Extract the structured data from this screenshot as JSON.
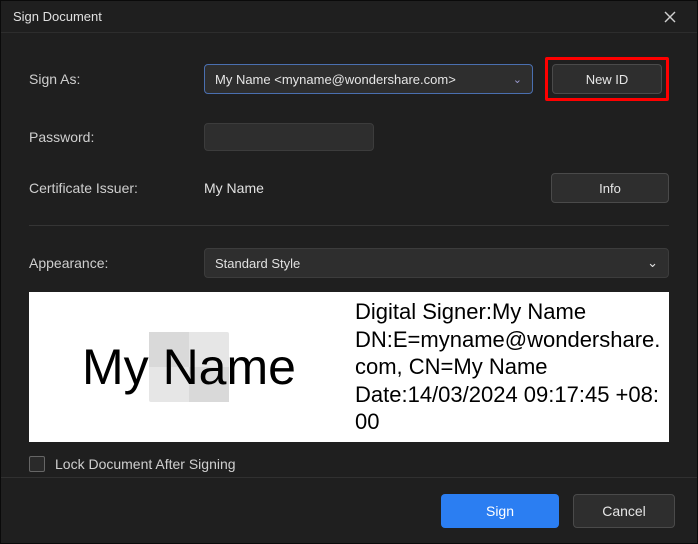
{
  "window": {
    "title": "Sign Document"
  },
  "labels": {
    "sign_as": "Sign As:",
    "password": "Password:",
    "cert_issuer": "Certificate Issuer:",
    "appearance": "Appearance:",
    "lock": "Lock Document After Signing"
  },
  "sign_as": {
    "selected": "My Name <myname@wondershare.com>",
    "new_id_label": "New ID"
  },
  "password": {
    "value": ""
  },
  "issuer": {
    "value": "My Name",
    "info_label": "Info"
  },
  "appearance": {
    "selected": "Standard Style"
  },
  "preview": {
    "name": "My Name",
    "line1": "Digital Signer:My Name",
    "line2": "DN:E=myname@wondershare.com, CN=My Name",
    "line3": "Date:14/03/2024 09:17:45 +08:00"
  },
  "footer": {
    "sign": "Sign",
    "cancel": "Cancel"
  }
}
